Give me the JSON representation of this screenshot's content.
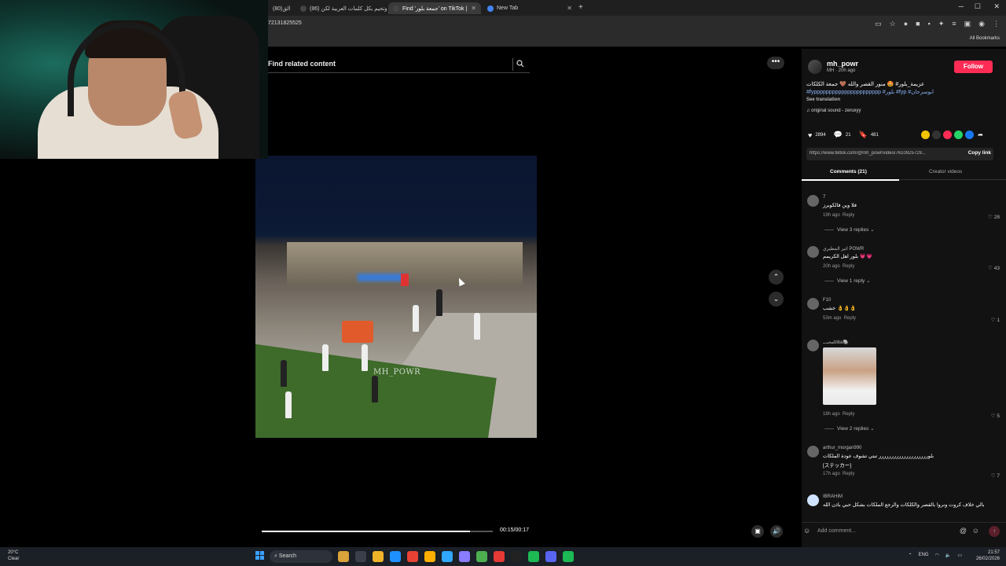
{
  "browser": {
    "tabs": [
      {
        "label": "(80)الق",
        "active": false
      },
      {
        "label": "وتحيم بكل كلمات العربية لكن (86)",
        "active": false
      },
      {
        "label": "Find 'جمعة بلور' on TikTok |",
        "active": true
      },
      {
        "label": "New Tab",
        "active": false
      }
    ],
    "url": "72131825525",
    "bookmarks_label": "All Bookmarks"
  },
  "video": {
    "search_placeholder": "Find related content",
    "watermark": "MH_POWR",
    "timecode": "00:15/00:17",
    "progress": 0.9
  },
  "post": {
    "username": "mh_powr",
    "meta": "MH · 20h ago",
    "follow_label": "Follow",
    "caption_line1": "عزيمة_بلور# 🤩 منور القصر والله 🤎 جمعة الكلكات",
    "caption_tags": "#fypppppppppppppppppppppp #بلور #fyp #ابوسرحان",
    "see_translation": "See translation",
    "sound": "♫ original sound - zeruxyy",
    "likes": "2894",
    "comments_count": "21",
    "saves": "481",
    "link": "https://www.tiktok.com/@mh_powr/video/7610925729...",
    "copy_link": "Copy link",
    "tab_comments": "Comments (21)",
    "tab_creator": "Creator videos"
  },
  "comments": [
    {
      "name": "7",
      "text": "فلا وين فالكوبرز",
      "time": "19h ago",
      "reply": "Reply",
      "likes": "28",
      "replies": "View 3 replies"
    },
    {
      "name": "اثير المطيري POWR",
      "text": "بلور اهل الكريمم 💗💗",
      "time": "20h ago",
      "reply": "Reply",
      "likes": "43",
      "replies": "View 1 reply"
    },
    {
      "name": "F10",
      "text": "خشب 👌👌👌",
      "time": "53m ago",
      "reply": "Reply",
      "likes": "1",
      "replies": ""
    },
    {
      "name": "محبـــbiba🐘",
      "text": "",
      "time": "18h ago",
      "reply": "Reply",
      "likes": "5",
      "replies": "View 2 replies"
    },
    {
      "name": "arthur_morgan990",
      "text": "بلورررررررررررررررررررر تبتي تشوف عودة الملكات",
      "text2": "[ステッカー]",
      "time": "17h ago",
      "reply": "Reply",
      "likes": "7",
      "replies": ""
    },
    {
      "name": "IBRAHIM",
      "text": "بالي خلاف كروت ونروا بالقصر والكلكات والرجع الملكات بشكل حبي باذن الله",
      "time": "",
      "reply": "",
      "likes": "",
      "replies": ""
    }
  ],
  "add_comment_placeholder": "Add comment...",
  "taskbar": {
    "weather_temp": "20°C",
    "weather_desc": "Clear",
    "search_label": "Search",
    "lang": "ENG",
    "time": "21:57",
    "date": "26/02/2026"
  },
  "colors": {
    "accent": "#fe2c55",
    "panel": "#121212",
    "link": "#8ab4f8"
  }
}
